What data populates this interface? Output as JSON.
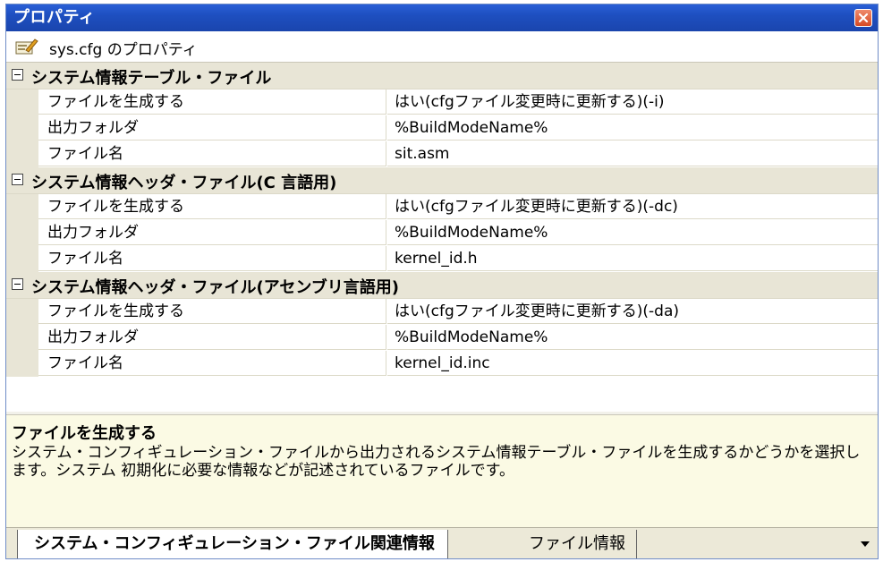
{
  "window": {
    "title": "プロパティ"
  },
  "header": {
    "caption": "sys.cfg のプロパティ"
  },
  "categories": [
    {
      "label": "システム情報テーブル・ファイル",
      "rows": [
        {
          "name": "ファイルを生成する",
          "value": "はい(cfgファイル変更時に更新する)(-i)"
        },
        {
          "name": "出力フォルダ",
          "value": "%BuildModeName%"
        },
        {
          "name": "ファイル名",
          "value": "sit.asm"
        }
      ]
    },
    {
      "label": "システム情報ヘッダ・ファイル(C 言語用)",
      "rows": [
        {
          "name": "ファイルを生成する",
          "value": "はい(cfgファイル変更時に更新する)(-dc)"
        },
        {
          "name": "出力フォルダ",
          "value": "%BuildModeName%"
        },
        {
          "name": "ファイル名",
          "value": "kernel_id.h"
        }
      ]
    },
    {
      "label": "システム情報ヘッダ・ファイル(アセンブリ言語用)",
      "rows": [
        {
          "name": "ファイルを生成する",
          "value": "はい(cfgファイル変更時に更新する)(-da)"
        },
        {
          "name": "出力フォルダ",
          "value": "%BuildModeName%"
        },
        {
          "name": "ファイル名",
          "value": "kernel_id.inc"
        }
      ]
    }
  ],
  "description": {
    "title": "ファイルを生成する",
    "body": "システム・コンフィギュレーション・ファイルから出力されるシステム情報テーブル・ファイルを生成するかどうかを選択します。システム 初期化に必要な情報などが記述されているファイルです。"
  },
  "tabs": [
    {
      "label": "システム・コンフィギュレーション・ファイル関連情報"
    },
    {
      "label": "ファイル情報"
    }
  ]
}
